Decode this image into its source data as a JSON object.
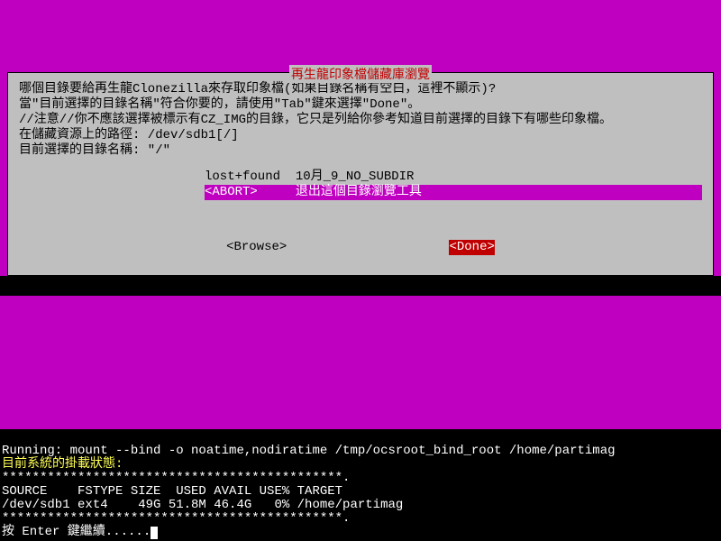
{
  "dialog": {
    "title": "再生龍印象檔儲藏庫瀏覽",
    "lines": [
      "哪個目錄要給再生龍Clonezilla來存取印象檔(如果目錄名稱有空白，這裡不顯示)?",
      "當\"目前選擇的目錄名稱\"符合你要的，請使用\"Tab\"鍵來選擇\"Done\"。",
      "//注意//你不應該選擇被標示有CZ_IMG的目錄，它只是列給你參考知道目前選擇的目錄下有哪些印象檔。",
      "在儲藏資源上的路徑: /dev/sdb1[/]",
      "目前選擇的目錄名稱: \"/\""
    ],
    "options": [
      {
        "label": "lost+found",
        "desc": "10月_9_NO_SUBDIR",
        "selected": false
      },
      {
        "label": "<ABORT>   ",
        "desc": "退出這個目錄瀏覽工具",
        "selected": true
      }
    ],
    "browse": "<Browse>",
    "done": "<Done>"
  },
  "terminal": {
    "running": "Running: mount --bind -o noatime,nodiratime /tmp/ocsroot_bind_root /home/partimag",
    "status_title": "目前系統的掛載狀態:",
    "stars": "*********************************************.",
    "header": "SOURCE    FSTYPE SIZE  USED AVAIL USE% TARGET",
    "row": "/dev/sdb1 ext4    49G 51.8M 46.4G   0% /home/partimag",
    "prompt": "按 Enter 鍵繼續......"
  }
}
